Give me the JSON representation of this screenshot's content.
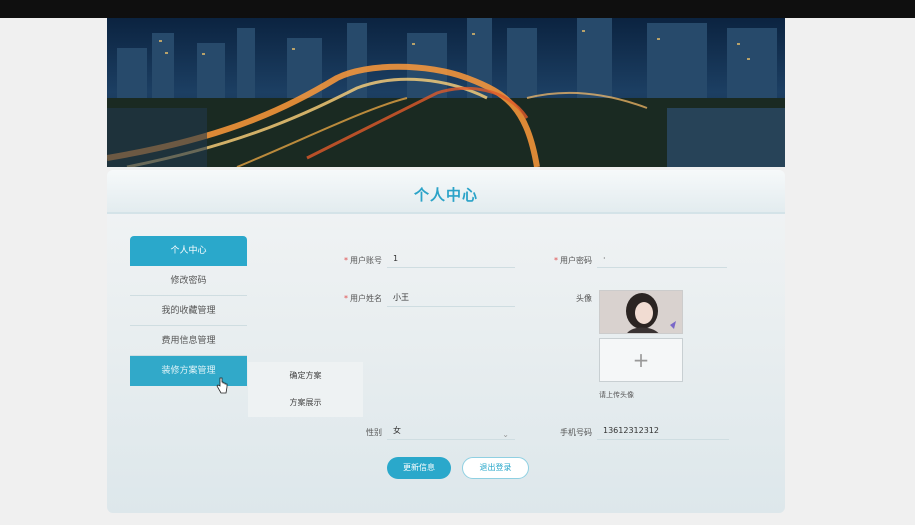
{
  "colors": {
    "accent": "#2aa8cb",
    "title": "#2ba3c8",
    "required": "#e05050"
  },
  "banner": {
    "image": "city-night-highway-banner"
  },
  "panel": {
    "title": "个人中心"
  },
  "menu": {
    "items": [
      {
        "label": "个人中心",
        "state": "active"
      },
      {
        "label": "修改密码",
        "state": "normal"
      },
      {
        "label": "我的收藏管理",
        "state": "normal"
      },
      {
        "label": "费用信息管理",
        "state": "normal"
      },
      {
        "label": "装修方案管理",
        "state": "hover"
      }
    ],
    "submenu": [
      {
        "label": "确定方案"
      },
      {
        "label": "方案展示"
      }
    ]
  },
  "form": {
    "account_label": "用户账号",
    "account_value": "1",
    "password_label": "用户密码",
    "password_value": "·",
    "name_label": "用户姓名",
    "name_value": "小王",
    "avatar_label": "头像",
    "upload_plus": "+",
    "upload_hint": "请上传头像",
    "gender_label": "性别",
    "gender_value": "女",
    "gender_arrow": "⌄",
    "phone_label": "手机号码",
    "phone_value": "13612312312"
  },
  "buttons": {
    "update": "更新信息",
    "logout": "退出登录"
  }
}
